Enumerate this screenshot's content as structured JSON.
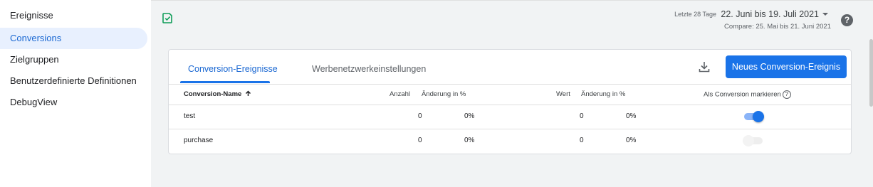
{
  "sidebar": {
    "items": [
      {
        "label": "Ereignisse"
      },
      {
        "label": "Conversions"
      },
      {
        "label": "Zielgruppen"
      },
      {
        "label": "Benutzerdefinierte Definitionen"
      },
      {
        "label": "DebugView"
      }
    ],
    "active_index": 1
  },
  "header": {
    "date_label": "Letzte 28 Tage",
    "date_range": "22. Juni bis 19. Juli 2021",
    "compare": "Compare: 25. Mai bis 21. Juni 2021",
    "help": "?"
  },
  "card": {
    "tabs": [
      {
        "label": "Conversion-Ereignisse"
      },
      {
        "label": "Werbenetzwerkeinstellungen"
      }
    ],
    "new_button": "Neues Conversion-Ereignis",
    "columns": {
      "name": "Conversion-Name",
      "count": "Anzahl",
      "count_change": "Änderung in %",
      "value": "Wert",
      "value_change": "Änderung in %",
      "mark": "Als Conversion markieren",
      "mark_help": "?"
    },
    "rows": [
      {
        "name": "test",
        "count": "0",
        "count_change": "0%",
        "value": "0",
        "value_change": "0%",
        "marked": true
      },
      {
        "name": "purchase",
        "count": "0",
        "count_change": "0%",
        "value": "0",
        "value_change": "0%",
        "marked": false
      }
    ]
  },
  "colors": {
    "accent": "#1a73e8",
    "active_nav_bg": "#e8f0fe",
    "save_icon": "#0f9d58"
  },
  "icons": {
    "save": "check-square-icon",
    "download": "download-icon",
    "help": "help-circle-icon",
    "sort": "arrow-up-icon",
    "dropdown": "caret-down-icon"
  }
}
